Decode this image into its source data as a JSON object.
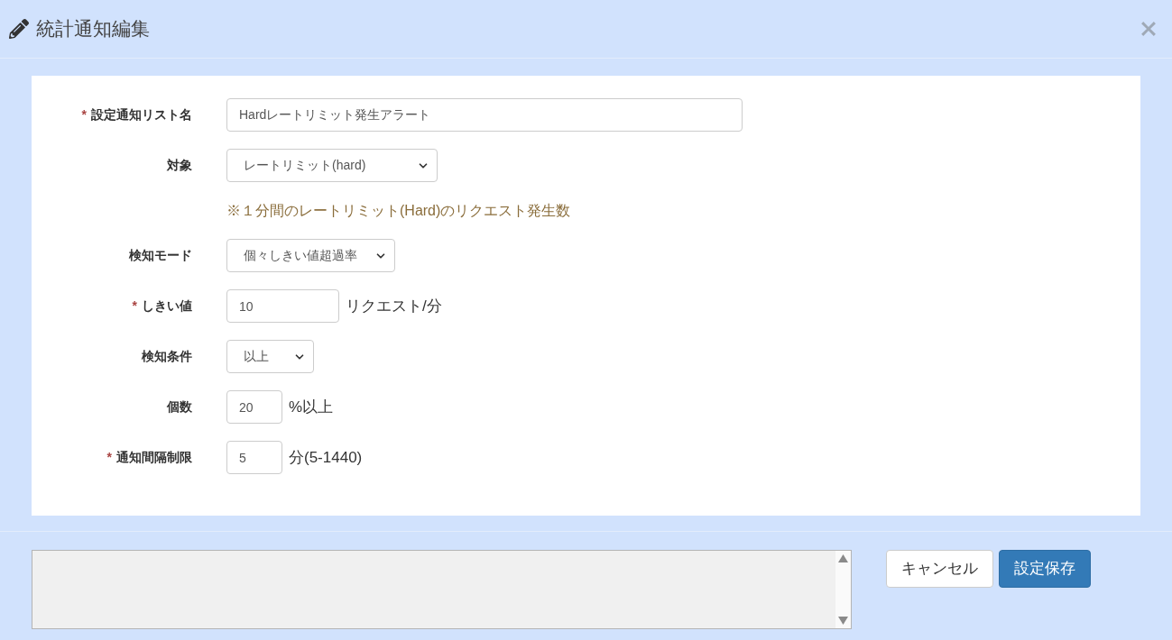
{
  "dialog": {
    "title": "統計通知編集"
  },
  "form": {
    "required_mark": "*",
    "fields": [
      {
        "kind": "text",
        "label": "設定通知リスト名",
        "required": true,
        "value": "Hardレートリミット発生アラート"
      },
      {
        "kind": "select",
        "label": "対象",
        "required": false,
        "value": "レートリミット(hard)",
        "note": "※１分間のレートリミット(Hard)のリクエスト発生数"
      },
      {
        "kind": "select",
        "label": "検知モード",
        "required": false,
        "value": "個々しきい値超過率"
      },
      {
        "kind": "text",
        "label": "しきい値",
        "required": true,
        "value": "10",
        "unit": "リクエスト/分"
      },
      {
        "kind": "select",
        "label": "検知条件",
        "required": false,
        "value": "以上"
      },
      {
        "kind": "text",
        "label": "個数",
        "required": false,
        "value": "20",
        "unit": "%以上"
      },
      {
        "kind": "text",
        "label": "通知間隔制限",
        "required": true,
        "value": "5",
        "unit": "分(5-1440)"
      }
    ]
  },
  "footer": {
    "buttons": [
      {
        "label": "キャンセル",
        "kind": "default"
      },
      {
        "label": "設定保存",
        "kind": "primary"
      }
    ]
  }
}
